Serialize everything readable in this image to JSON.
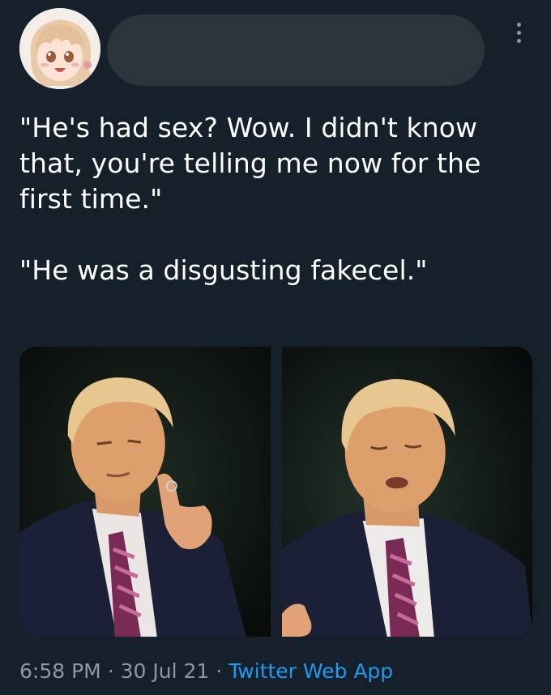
{
  "tweet": {
    "text_line_1": "\"He's had sex? Wow. I didn't know that, you're telling me now for the first time.\"",
    "text_line_2": "\"He was a disgusting fakecel.\"",
    "time": "6:58 PM",
    "separator": "·",
    "date": "30 Jul 21",
    "source": "Twitter Web App"
  },
  "icons": {
    "more": "more-vertical-icon",
    "avatar": "anime-girl-avatar"
  },
  "colors": {
    "background": "#15202b",
    "text": "#ffffff",
    "secondary_text": "#8b98a5",
    "link": "#1d9bf0",
    "redacted_name": "#2b343d"
  }
}
